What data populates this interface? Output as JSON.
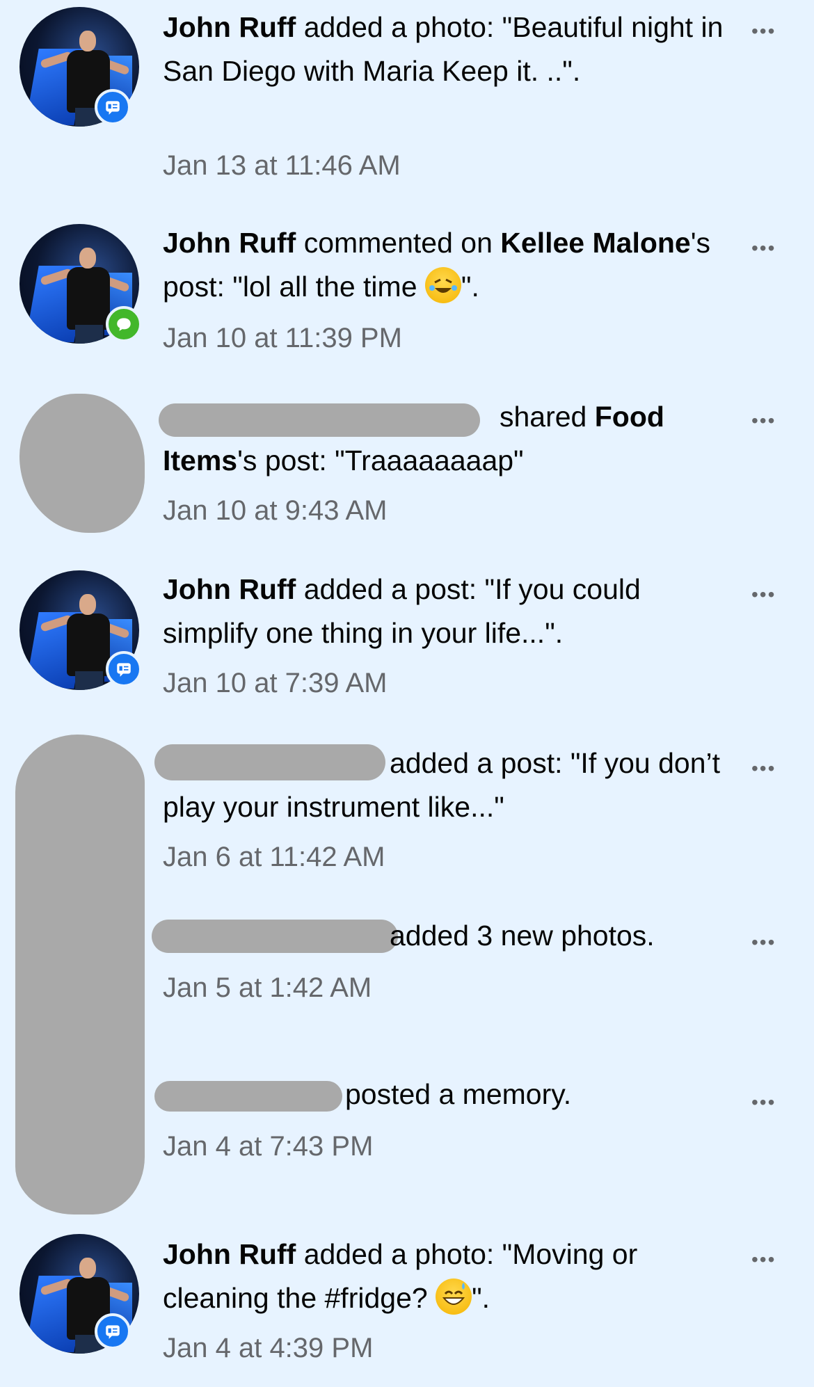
{
  "items": [
    {
      "actor": "John Ruff",
      "action_pre": " added a photo: \"Beautiful night in San Diego with Maria Keep it. ..\".",
      "time": "Jan 13 at 11:46 AM",
      "badge_icon": "post-icon"
    },
    {
      "actor": "John Ruff",
      "action_pre": " commented on ",
      "target": "Kellee Malone",
      "action_post": "'s post: \"lol all the time ",
      "action_end": "\".",
      "time": "Jan 10 at 11:39 PM",
      "badge_icon": "comment-icon"
    },
    {
      "actor_redacted": true,
      "action_pre": "shared ",
      "target": "Food Items",
      "action_post": "'s post: \"Traaaaaaaap\"",
      "time": "Jan 10 at 9:43 AM"
    },
    {
      "actor": "John Ruff",
      "action_pre": " added a post: \"If you could simplify one thing in your life...\".",
      "time": "Jan 10 at 7:39 AM",
      "badge_icon": "post-icon"
    },
    {
      "actor_redacted": true,
      "action_pre": "added a post: \"If you don’t play your instrument like...\"",
      "time": "Jan 6 at 11:42 AM"
    },
    {
      "actor_redacted": true,
      "action_pre": "added 3 new photos.",
      "time": "Jan 5 at 1:42 AM"
    },
    {
      "actor_redacted": true,
      "action_pre": "posted a memory.",
      "time": "Jan 4 at 7:43 PM"
    },
    {
      "actor": "John Ruff",
      "action_pre": " added a photo: \"Moving or cleaning the #fridge? ",
      "action_end": "\".",
      "time": "Jan 4 at 4:39 PM",
      "badge_icon": "post-icon"
    }
  ],
  "more_label": "•••",
  "colors": {
    "background": "#e7f3ff",
    "secondary_text": "#65676b",
    "badge_blue": "#1877f2",
    "badge_green": "#42b72a",
    "redaction": "#a9a9a9"
  }
}
